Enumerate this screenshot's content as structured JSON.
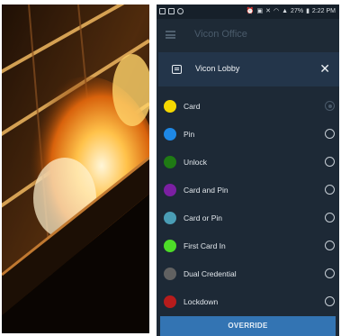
{
  "status_bar": {
    "battery": "27%",
    "time": "2:22 PM"
  },
  "app": {
    "title": "Vicon Office"
  },
  "panel": {
    "title": "Vicon Lobby",
    "close_label": "✕"
  },
  "options": [
    {
      "label": "Card",
      "color": "#f5d800",
      "selected": true
    },
    {
      "label": "Pin",
      "color": "#1e88e5",
      "selected": false
    },
    {
      "label": "Unlock",
      "color": "#1f7a14",
      "selected": false
    },
    {
      "label": "Card and Pin",
      "color": "#7b1fa2",
      "selected": false
    },
    {
      "label": "Card or Pin",
      "color": "#4a9db5",
      "selected": false
    },
    {
      "label": "First Card In",
      "color": "#4ddc28",
      "selected": false
    },
    {
      "label": "Dual Credential",
      "color": "#616161",
      "selected": false
    },
    {
      "label": "Lockdown",
      "color": "#b71c1c",
      "selected": false
    }
  ],
  "actions": {
    "override_label": "OVERRIDE"
  }
}
